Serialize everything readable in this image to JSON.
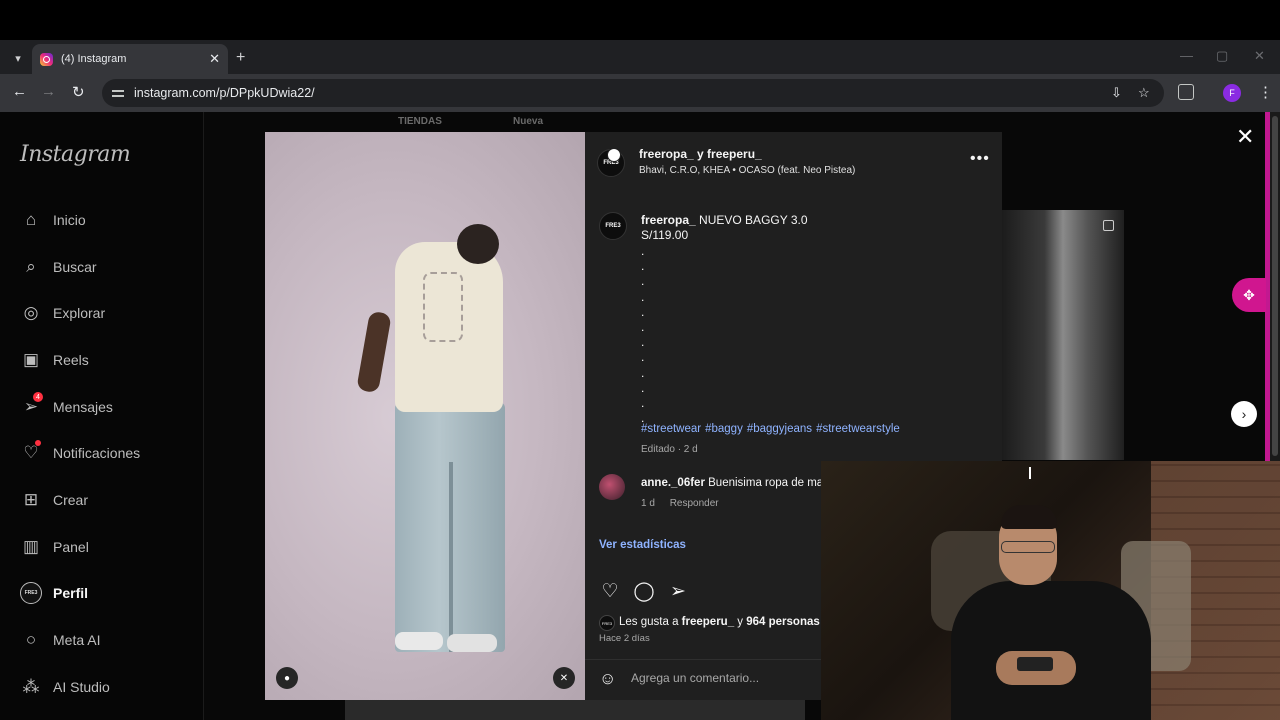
{
  "browser": {
    "tab_title": "(4) Instagram",
    "url": "instagram.com/p/DPpkUDwia22/",
    "profile_initial": "F"
  },
  "sidebar": {
    "logo": "Instagram",
    "items": [
      {
        "label": "Inicio",
        "icon": "home-icon"
      },
      {
        "label": "Buscar",
        "icon": "search-icon"
      },
      {
        "label": "Explorar",
        "icon": "compass-icon"
      },
      {
        "label": "Reels",
        "icon": "reels-icon"
      },
      {
        "label": "Mensajes",
        "icon": "messenger-icon",
        "badge": "4"
      },
      {
        "label": "Notificaciones",
        "icon": "heart-icon",
        "dot": true
      },
      {
        "label": "Crear",
        "icon": "plus-square-icon"
      },
      {
        "label": "Panel",
        "icon": "dashboard-icon"
      },
      {
        "label": "Perfil",
        "icon": "profile-avatar"
      },
      {
        "label": "Meta AI",
        "icon": "meta-ai-icon"
      },
      {
        "label": "AI Studio",
        "icon": "ai-studio-icon"
      }
    ]
  },
  "background": {
    "tabs": [
      "TIENDAS",
      "Nueva"
    ]
  },
  "post": {
    "header": {
      "names": "freeropa_ y freeperu_",
      "audio": "Bhavi, C.R.O, KHEA • OCASO (feat. Neo Pistea)",
      "avatar_text": "FRE3"
    },
    "caption": {
      "username": "freeropa_",
      "text": "NUEVO BAGGY 3.0",
      "price": "S/119.00",
      "dots": [
        ".",
        ".",
        ".",
        ".",
        ".",
        ".",
        ".",
        ".",
        ".",
        ".",
        ".",
        "."
      ],
      "hashtags": [
        "#streetwear",
        "#baggy",
        "#baggyjeans",
        "#streetwearstyle"
      ],
      "edited": "Editado · 2 d"
    },
    "comment": {
      "username": "anne._06fer",
      "text": "Buenisima ropa de ma",
      "time": "1 d",
      "reply": "Responder"
    },
    "stats_link": "Ver estadísticas",
    "likes": {
      "prefix": "Les gusta a",
      "user": "freeperu_",
      "conj": "y",
      "others": "964 personas m"
    },
    "posted": "Hace 2 días",
    "comment_placeholder": "Agrega un comentario..."
  }
}
